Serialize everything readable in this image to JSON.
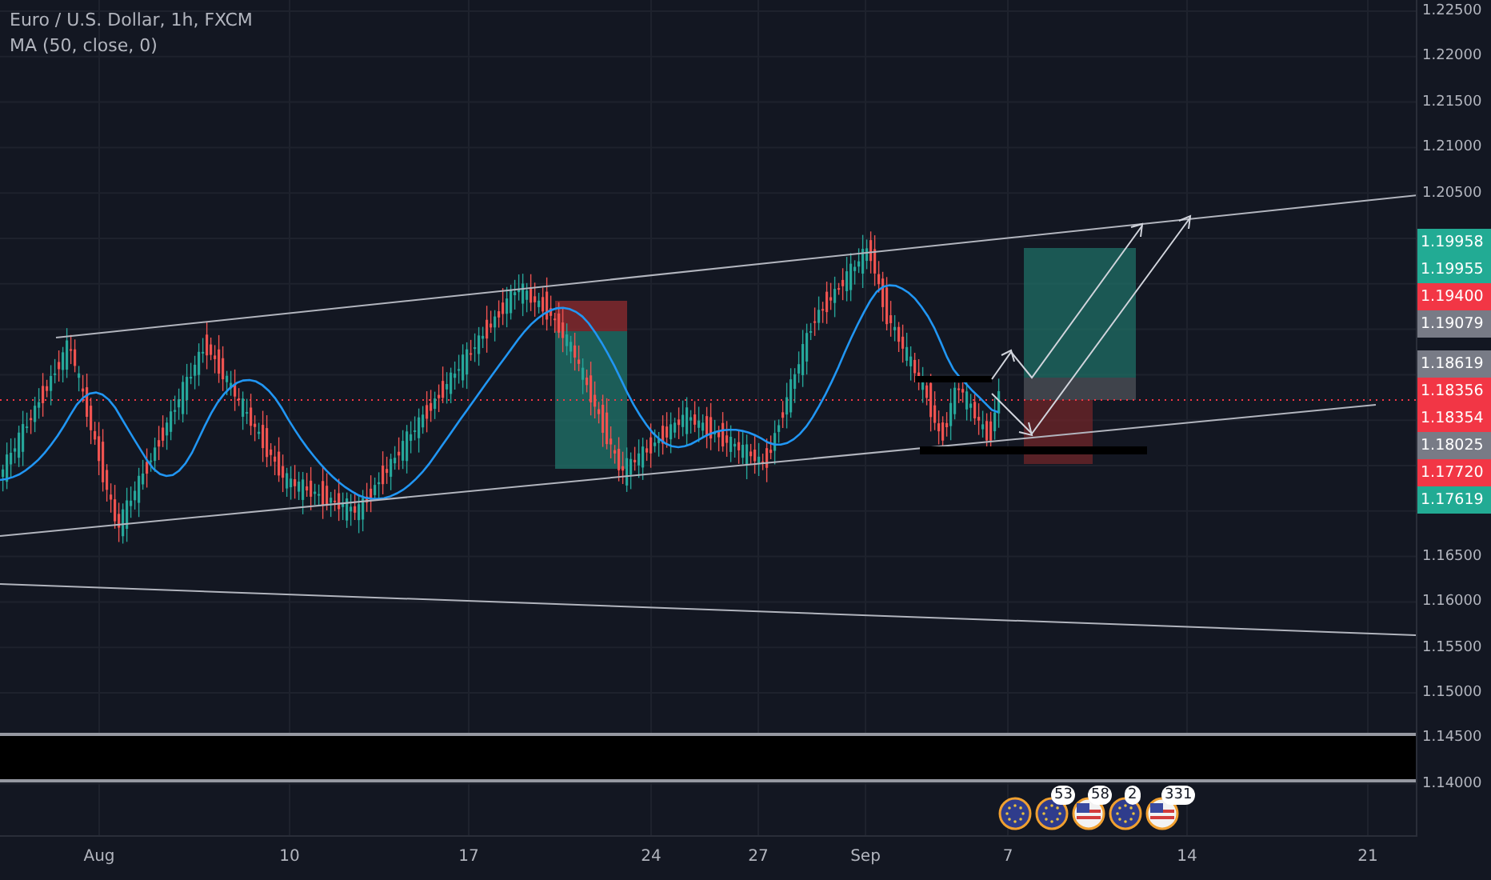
{
  "legend": {
    "symbol": "Euro / U.S. Dollar, 1h, FXCM",
    "indicator": "MA (50, close, 0)"
  },
  "price_axis": {
    "ticks": [
      "1.22500",
      "1.22000",
      "1.21500",
      "1.21000",
      "1.20500",
      "1.16500",
      "1.16000",
      "1.15500",
      "1.15000",
      "1.14500",
      "1.14000"
    ],
    "labels": [
      {
        "text": "1.19958",
        "color": "#22ab94"
      },
      {
        "text": "1.19955",
        "color": "#22ab94"
      },
      {
        "text": "1.19400",
        "color": "#f23645"
      },
      {
        "text": "1.19079",
        "color": "#787b86"
      },
      {
        "text": "1.18619",
        "color": "#787b86"
      },
      {
        "text": "1.18356",
        "color": "#f23645"
      },
      {
        "text": "1.18354",
        "color": "#f23645"
      },
      {
        "text": "1.18025",
        "color": "#787b86"
      },
      {
        "text": "1.17720",
        "color": "#f23645"
      },
      {
        "text": "1.17619",
        "color": "#22ab94"
      }
    ]
  },
  "time_axis": {
    "labels": [
      "Aug",
      "10",
      "17",
      "24",
      "27",
      "Sep",
      "7",
      "14",
      "21"
    ]
  },
  "events": [
    {
      "kind": "eu"
    },
    {
      "kind": "eu",
      "badge": "53"
    },
    {
      "kind": "us",
      "badge": "58"
    },
    {
      "kind": "eu",
      "badge": "2"
    },
    {
      "kind": "us",
      "badge": "331"
    }
  ]
}
